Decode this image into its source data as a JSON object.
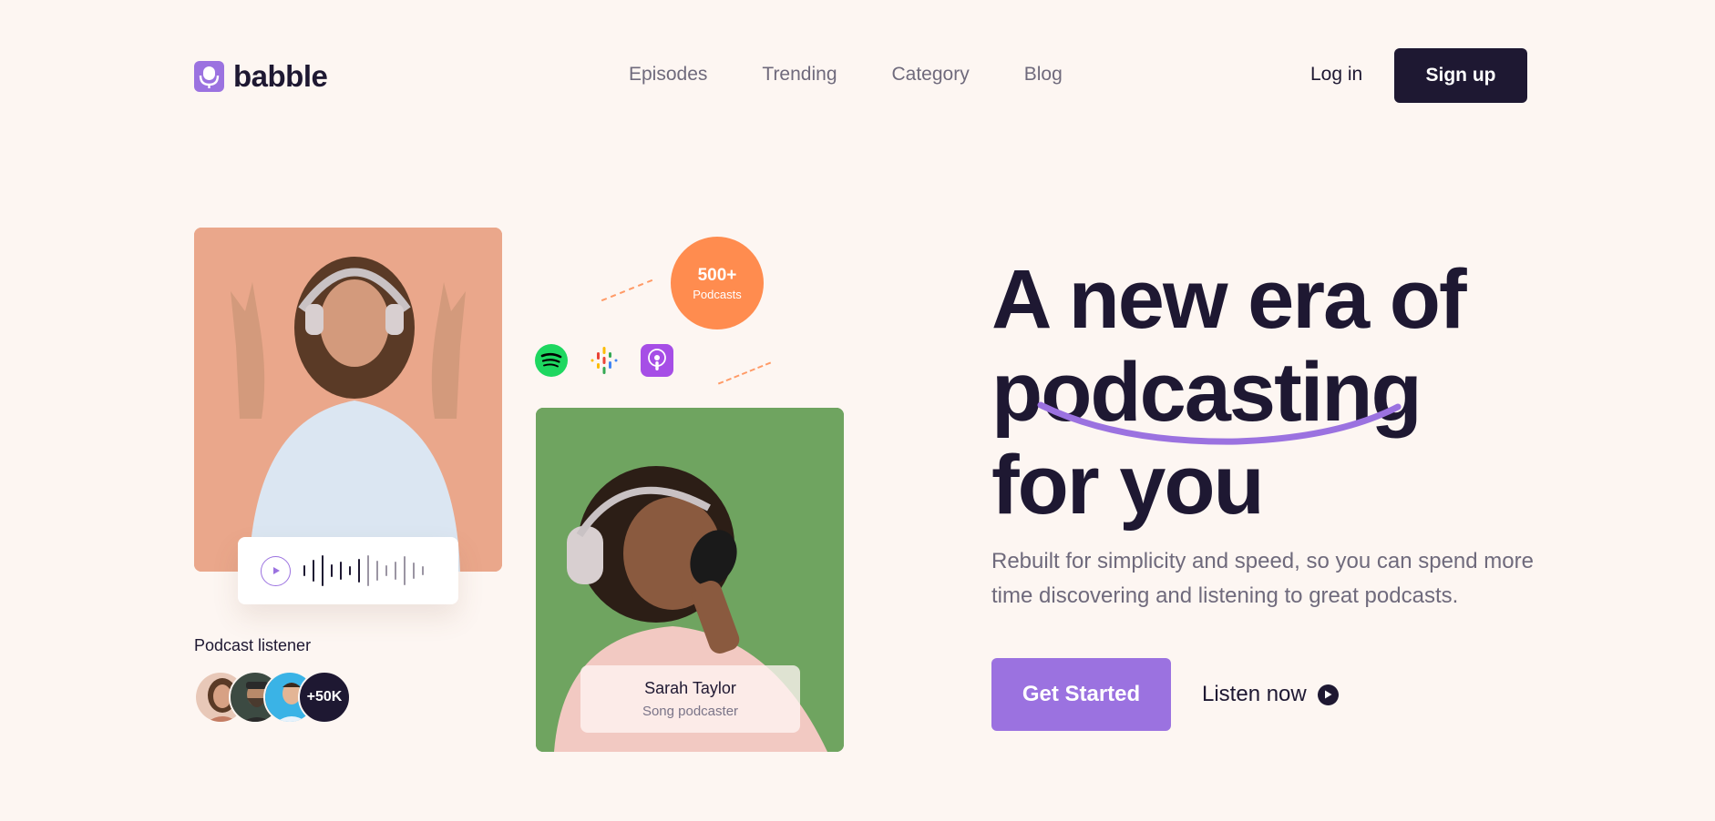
{
  "brand": {
    "name": "babble",
    "icon": "microphone-icon",
    "color": "#9b72e0"
  },
  "nav": {
    "items": [
      "Episodes",
      "Trending",
      "Category",
      "Blog"
    ]
  },
  "auth": {
    "login_label": "Log in",
    "signup_label": "Sign up"
  },
  "hero": {
    "headline_lines": [
      "A new era of",
      "podcasting",
      "for you"
    ],
    "subtitle": "Rebuilt for simplicity and speed, so you can spend more time discovering and listening to great podcasts.",
    "cta_label": "Get Started",
    "listen_label": "Listen now",
    "listen_icon": "play-circle-icon"
  },
  "visual": {
    "player": {
      "play_icon": "play-icon",
      "wave_icon": "waveform-icon"
    },
    "podcasts_badge": {
      "count": "500+",
      "label": "Podcasts"
    },
    "platforms": [
      "spotify-icon",
      "google-podcasts-icon",
      "apple-podcasts-icon"
    ],
    "host": {
      "name": "Sarah Taylor",
      "role": "Song podcaster"
    },
    "listeners": {
      "label": "Podcast listener",
      "count": "+50K"
    }
  },
  "colors": {
    "background": "#fdf6f2",
    "dark": "#1e1832",
    "accent": "#9b72e0",
    "orange": "#ff8c4f",
    "muted": "#6f6a7c"
  }
}
